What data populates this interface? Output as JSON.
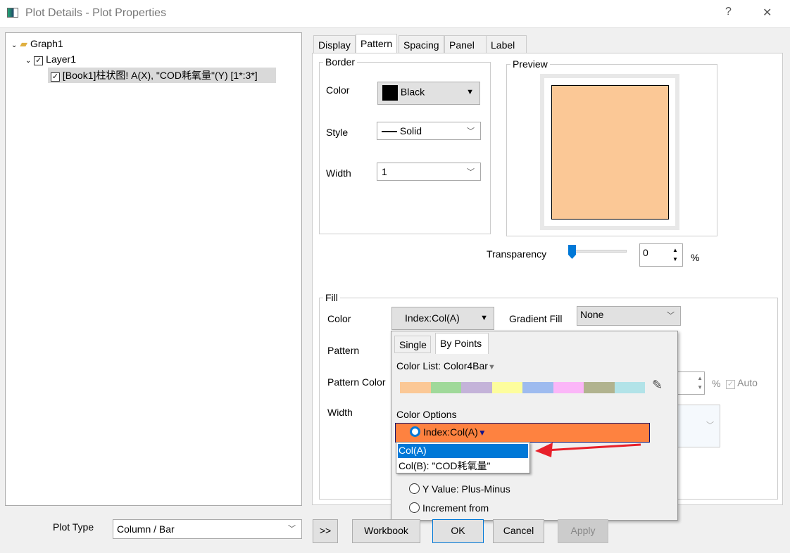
{
  "window": {
    "title": "Plot Details - Plot Properties",
    "help": "?",
    "close": "✕"
  },
  "tree": {
    "graph": "Graph1",
    "layer": "Layer1",
    "plot": "[Book1]柱状图! A(X), \"COD耗氧量\"(Y) [1*:3*]"
  },
  "tabs": [
    "Display",
    "Pattern",
    "Spacing",
    "Panel",
    "Label"
  ],
  "border": {
    "title": "Border",
    "color_label": "Color",
    "color_value": "Black",
    "style_label": "Style",
    "style_value": "Solid",
    "width_label": "Width",
    "width_value": "1"
  },
  "preview": {
    "title": "Preview",
    "fill": "#fbc896"
  },
  "transparency": {
    "label": "Transparency",
    "value": "0",
    "unit": "%",
    "level": 0
  },
  "fill": {
    "title": "Fill",
    "color_label": "Color",
    "color_value": "Index:Col(A)",
    "gradient_label": "Gradient Fill",
    "gradient_value": "None",
    "pattern_label": "Pattern",
    "pattern_color_label": "Pattern Color",
    "width_label": "Width",
    "percent": "%",
    "auto_label": "Auto"
  },
  "popup": {
    "tabs": [
      "Single",
      "By Points"
    ],
    "color_list": "Color List: Color4Bar",
    "swatches": [
      "#fbc896",
      "#a0d99a",
      "#c4b3d9",
      "#fdfd9d",
      "#9ebbef",
      "#fbb6f8",
      "#b1b38f",
      "#b2e3e8"
    ],
    "options_label": "Color Options",
    "selected": "Index:Col(A)",
    "dropdown": [
      "Col(A)",
      "Col(B): \"COD耗氧量\""
    ],
    "radios": [
      "Y Value: Plus-Minus",
      "Increment from"
    ]
  },
  "bottom": {
    "plot_type_label": "Plot Type",
    "plot_type_value": "Column / Bar",
    "expand": ">>",
    "workbook": "Workbook",
    "ok": "OK",
    "cancel": "Cancel",
    "apply": "Apply"
  }
}
